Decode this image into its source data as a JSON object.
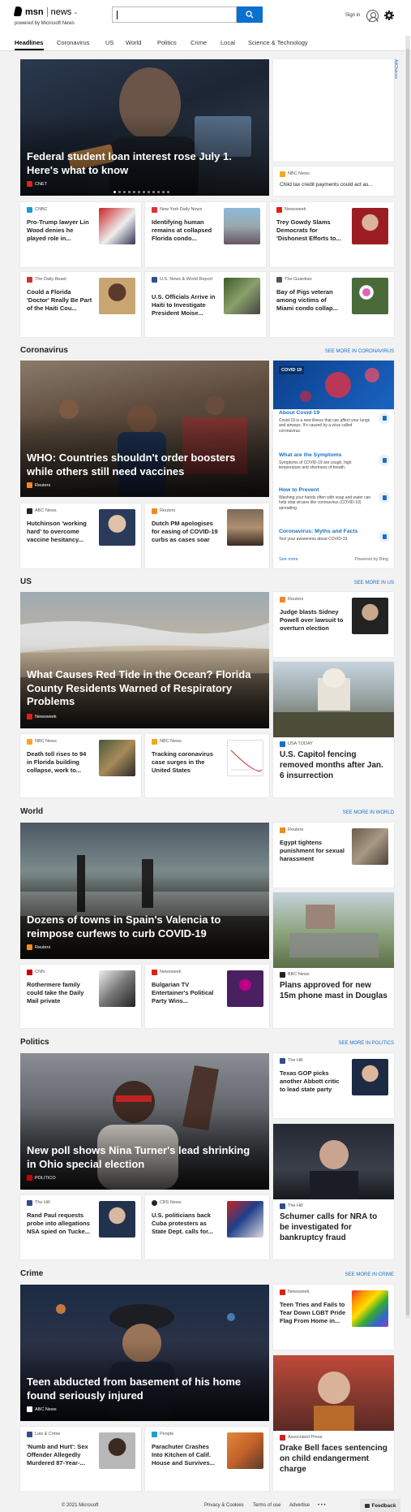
{
  "header": {
    "logo_msn": "msn",
    "logo_news": "news",
    "powered_by": "powered by Microsoft News",
    "sign_in": "Sign in"
  },
  "nav": {
    "items": [
      "Headlines",
      "Coronavirus",
      "US",
      "World",
      "Politics",
      "Crime",
      "Local",
      "Science & Technology"
    ]
  },
  "adchoices": "AdChoices",
  "top": {
    "hero": {
      "title": "Federal student loan interest rose July 1. Here's what to know",
      "source": "CNET"
    },
    "side": {
      "source": "NBC News",
      "headline": "Child tax credit payments could act as..."
    },
    "row1": [
      {
        "source": "CNBC",
        "headline": "Pro-Trump lawyer Lin Wood denies he played role in..."
      },
      {
        "source": "New York Daily News",
        "headline": "Identifying human remains at collapsed Florida condo..."
      },
      {
        "source": "Newsweek",
        "headline": "Trey Gowdy Slams Democrats for 'Dishonest Efforts to..."
      }
    ],
    "row2": [
      {
        "source": "The Daily Beast",
        "headline": "Could a Florida 'Doctor' Really Be Part of the Haiti Cou..."
      },
      {
        "source": "U.S. News & World Report",
        "headline": "U.S. Officials Arrive in Haiti to Investigate President Moise..."
      },
      {
        "source": "The Guardian",
        "headline": "Bay of Pigs veteran among victims of Miami condo collap..."
      }
    ]
  },
  "coronavirus": {
    "title": "Coronavirus",
    "see_more": "SEE MORE IN CORONAVIRUS",
    "hero": {
      "title": "WHO: Countries shouldn't order boosters while others still need vaccines",
      "source": "Reuters"
    },
    "cards": [
      {
        "source": "ABC News",
        "headline": "Hutchinson 'working hard' to overcome vaccine hesitancy..."
      },
      {
        "source": "Reuters",
        "headline": "Dutch PM apologises for easing of COVID-19 curbs as cases soar"
      }
    ],
    "panel": {
      "badge": "COVID 19",
      "items": [
        {
          "title": "About Covid-19",
          "desc": "Covid-19 is a new illness that can affect your lungs and airways. It's caused by a virus called coronavirus."
        },
        {
          "title": "What are the Symptoms",
          "desc": "Symptoms of COVID-19 are cough, high temperature and shortness of breath."
        },
        {
          "title": "How to Prevent",
          "desc": "Washing your hands often with soap and water can help stop viruses like coronavirus (COVID-19) spreading."
        },
        {
          "title": "Coronavirus: Myths and Facts",
          "desc": "Test your awareness about COVID-19."
        }
      ],
      "see_more": "See more",
      "powered": "Powered by Bing"
    }
  },
  "us": {
    "title": "US",
    "see_more": "SEE MORE IN US",
    "hero": {
      "title": "What Causes Red Tide in the Ocean? Florida County Residents Warned of Respiratory Problems",
      "source": "Newsweek"
    },
    "side1": {
      "source": "Reuters",
      "headline": "Judge blasts Sidney Powell over lawsuit to overturn election"
    },
    "side2": {
      "source": "USA TODAY",
      "headline": "U.S. Capitol fencing removed months after Jan. 6 insurrection"
    },
    "cards": [
      {
        "source": "NBC News",
        "headline": "Death toll rises to 94 in Florida building collapse, work to..."
      },
      {
        "source": "NBC News",
        "headline": "Tracking coronavirus case surges in the United States"
      }
    ]
  },
  "world": {
    "title": "World",
    "see_more": "SEE MORE IN WORLD",
    "hero": {
      "title": "Dozens of towns in Spain's Valencia to reimpose curfews to curb COVID-19",
      "source": "Reuters"
    },
    "side1": {
      "source": "Reuters",
      "headline": "Egypt tightens punishment for sexual harassment"
    },
    "side2": {
      "source": "BBC News",
      "headline": "Plans approved for new 15m phone mast in Douglas"
    },
    "cards": [
      {
        "source": "CNN",
        "headline": "Rothermere family could take the Daily Mail private"
      },
      {
        "source": "Newsweek",
        "headline": "Bulgarian TV Entertainer's Political Party Wins..."
      }
    ]
  },
  "politics": {
    "title": "Politics",
    "see_more": "SEE MORE IN POLITICS",
    "hero": {
      "title": "New poll shows Nina Turner's lead shrinking in Ohio special election",
      "source": "POLITICO"
    },
    "side1": {
      "source": "The Hill",
      "headline": "Texas GOP picks another Abbott critic to lead state party"
    },
    "side2": {
      "source": "The Hill",
      "headline": "Schumer calls for NRA to be investigated for bankruptcy fraud"
    },
    "cards": [
      {
        "source": "The Hill",
        "headline": "Rand Paul requests probe into allegations NSA spied on Tucke..."
      },
      {
        "source": "CBS News",
        "headline": "U.S. politicians back Cuba protesters as State Dept. calls for..."
      }
    ]
  },
  "crime": {
    "title": "Crime",
    "see_more": "SEE MORE IN CRIME",
    "hero": {
      "title": "Teen abducted from basement of his home found seriously injured",
      "source": "ABC News"
    },
    "side1": {
      "source": "Newsweek",
      "headline": "Teen Tries and Fails to Tear Down LGBT Pride Flag From Home in..."
    },
    "side2": {
      "source": "Associated Press",
      "headline": "Drake Bell faces sentencing on child endangerment charge"
    },
    "cards": [
      {
        "source": "Law & Crime",
        "headline": "'Numb and Hurt': Sex Offender Allegedly Murdered 87-Year-..."
      },
      {
        "source": "People",
        "headline": "Parachuter Crashes Into Kitchen of Calif. House and Survives..."
      }
    ]
  },
  "footer": {
    "copyright": "© 2021 Microsoft",
    "links": [
      "Privacy & Cookies",
      "Terms of use",
      "Advertise"
    ],
    "more": "• • •",
    "feedback": "Feedback"
  },
  "colors": {
    "accent": "#0b6fd0",
    "link": "#1a6fc8",
    "background": "#f2f2f2"
  }
}
